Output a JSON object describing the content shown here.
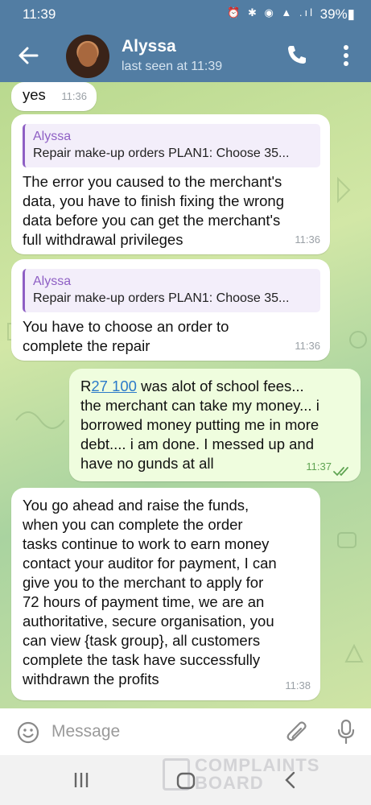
{
  "status_bar": {
    "time": "11:39",
    "icons": "⏰ ✱ ◉ ▲ .ıl",
    "battery": "39%▮"
  },
  "header": {
    "contact_name": "Alyssa",
    "contact_status": "last seen at 11:39",
    "icons": {
      "back": "arrow-left-icon",
      "call": "phone-icon",
      "menu": "more-vertical-icon"
    }
  },
  "messages": [
    {
      "id": "m1",
      "direction": "in",
      "text": "yes",
      "time": "11:36"
    },
    {
      "id": "m2",
      "direction": "in",
      "reply_name": "Alyssa",
      "reply_text": "Repair make-up orders PLAN1: Choose 35...",
      "lines": [
        "The error you caused to the merchant's",
        "data, you have to finish fixing the wrong",
        "data before you can get the merchant's",
        "full withdrawal privileges"
      ],
      "time": "11:36"
    },
    {
      "id": "m3",
      "direction": "in",
      "reply_name": "Alyssa",
      "reply_text": "Repair make-up orders PLAN1: Choose 35...",
      "lines": [
        "You have to choose an order to",
        "complete the repair"
      ],
      "time": "11:36"
    },
    {
      "id": "m4",
      "direction": "out",
      "first_prefix": "R",
      "first_link": "27 100",
      "first_rest": " was alot of school fees...",
      "lines": [
        "the merchant can take my money... i",
        "borrowed money putting me in more",
        "debt.... i am done. I messed up and",
        "have no gunds at all"
      ],
      "time": "11:37",
      "read": true
    },
    {
      "id": "m5",
      "direction": "in",
      "lines": [
        "You go ahead and raise the funds,",
        "when you can complete the order",
        "tasks continue to work to earn money",
        "contact your auditor for payment, I can",
        "give you to the merchant to apply for",
        "72 hours of payment time, we are an",
        "authoritative, secure organisation, you",
        "can view {task group}, all customers",
        "complete the task have successfully",
        "withdrawn the profits"
      ],
      "time": "11:38"
    }
  ],
  "input_bar": {
    "placeholder": "Message",
    "icons": {
      "emoji": "emoji-icon",
      "attach": "paperclip-icon",
      "mic": "microphone-icon"
    }
  },
  "nav_bar": {
    "icons": [
      "recent-apps-icon",
      "home-icon",
      "back-icon"
    ]
  },
  "watermark": {
    "line1": "COMPLAINTS",
    "line2": "BOARD"
  },
  "colors": {
    "header": "#527da3",
    "bubble_in": "#ffffff",
    "bubble_out": "#effdde",
    "reply_accent": "#8e5fc4",
    "link": "#2c7bc9"
  }
}
